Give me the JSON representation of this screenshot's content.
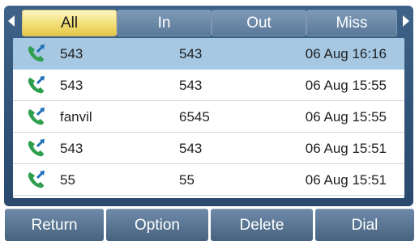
{
  "tabs": [
    {
      "label": "All",
      "active": true
    },
    {
      "label": "In",
      "active": false
    },
    {
      "label": "Out",
      "active": false
    },
    {
      "label": "Miss",
      "active": false
    }
  ],
  "calls": [
    {
      "name": "543",
      "number": "543",
      "time": "06 Aug 16:16",
      "selected": true,
      "icon": "outgoing-call-icon"
    },
    {
      "name": "543",
      "number": "543",
      "time": "06 Aug 15:55",
      "selected": false,
      "icon": "outgoing-call-icon"
    },
    {
      "name": "fanvil",
      "number": "6545",
      "time": "06 Aug 15:55",
      "selected": false,
      "icon": "outgoing-call-icon"
    },
    {
      "name": "543",
      "number": "543",
      "time": "06 Aug 15:51",
      "selected": false,
      "icon": "outgoing-call-icon"
    },
    {
      "name": "55",
      "number": "55",
      "time": "06 Aug 15:51",
      "selected": false,
      "icon": "outgoing-call-icon"
    }
  ],
  "softkeys": {
    "return_label": "Return",
    "option_label": "Option",
    "delete_label": "Delete",
    "dial_label": "Dial"
  },
  "colors": {
    "call_icon_green": "#2e9e4f",
    "call_arrow_blue": "#1f6fb8",
    "selected_row": "#a6c8e3",
    "active_tab": "#f2df74"
  }
}
